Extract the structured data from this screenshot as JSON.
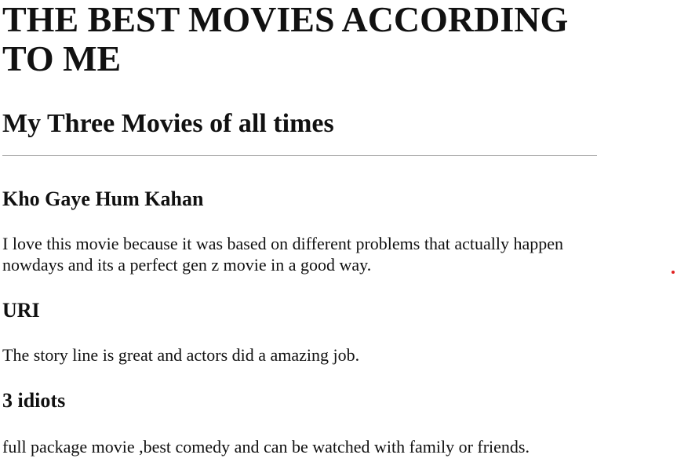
{
  "page": {
    "title": "THE BEST MOVIES ACCORDING TO ME",
    "subtitle": "My Three Movies of all times"
  },
  "movies": [
    {
      "name": "Kho Gaye Hum Kahan",
      "description": "I love this movie because it was based on different problems that actually happen nowdays and its a perfect gen z movie in a good way."
    },
    {
      "name": "URI",
      "description": "The story line is great and actors did a amazing job."
    },
    {
      "name": "3 idiots",
      "description": "full package movie ,best comedy and can be watched with family or friends."
    }
  ],
  "colors": {
    "text": "#111111",
    "divider": "#9a9a9a",
    "dot": "#e02020"
  }
}
